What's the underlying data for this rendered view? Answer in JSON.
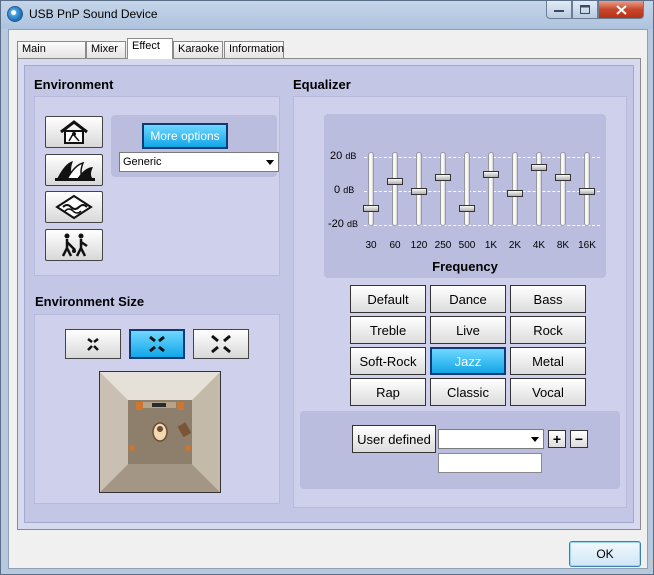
{
  "window": {
    "title": "USB PnP Sound Device"
  },
  "tabs": [
    {
      "label": "Main Setting"
    },
    {
      "label": "Mixer"
    },
    {
      "label": "Effect"
    },
    {
      "label": "Karaoke"
    },
    {
      "label": "Information"
    }
  ],
  "active_tab": "Effect",
  "environment": {
    "title": "Environment",
    "icons": [
      "home-icon",
      "opera-house-icon",
      "water-icon",
      "hunter-icon"
    ],
    "more_options_label": "More options",
    "selected_environment": "Generic"
  },
  "environment_size": {
    "title": "Environment Size",
    "options": [
      "small-room-icon",
      "medium-room-icon",
      "large-room-icon"
    ],
    "selected_index": 1
  },
  "equalizer": {
    "title": "Equalizer",
    "db_labels": {
      "top": "20",
      "mid": "0",
      "bottom": "-20",
      "unit": "dB"
    },
    "frequency_title": "Frequency",
    "bands": [
      {
        "label": "30",
        "gain": -10
      },
      {
        "label": "60",
        "gain": 6
      },
      {
        "label": "120",
        "gain": 0
      },
      {
        "label": "250",
        "gain": 8
      },
      {
        "label": "500",
        "gain": -10
      },
      {
        "label": "1K",
        "gain": 10
      },
      {
        "label": "2K",
        "gain": -1
      },
      {
        "label": "4K",
        "gain": 14
      },
      {
        "label": "8K",
        "gain": 8
      },
      {
        "label": "16K",
        "gain": 0
      }
    ],
    "presets": [
      "Default",
      "Dance",
      "Bass",
      "Treble",
      "Live",
      "Rock",
      "Soft-Rock",
      "Jazz",
      "Metal",
      "Rap",
      "Classic",
      "Vocal"
    ],
    "active_preset": "Jazz",
    "user_defined_label": "User defined",
    "add_label": "+",
    "remove_label": "−"
  },
  "ok_label": "OK",
  "colors": {
    "accent": "#12a6e8",
    "accent_border": "#0d3b76"
  }
}
